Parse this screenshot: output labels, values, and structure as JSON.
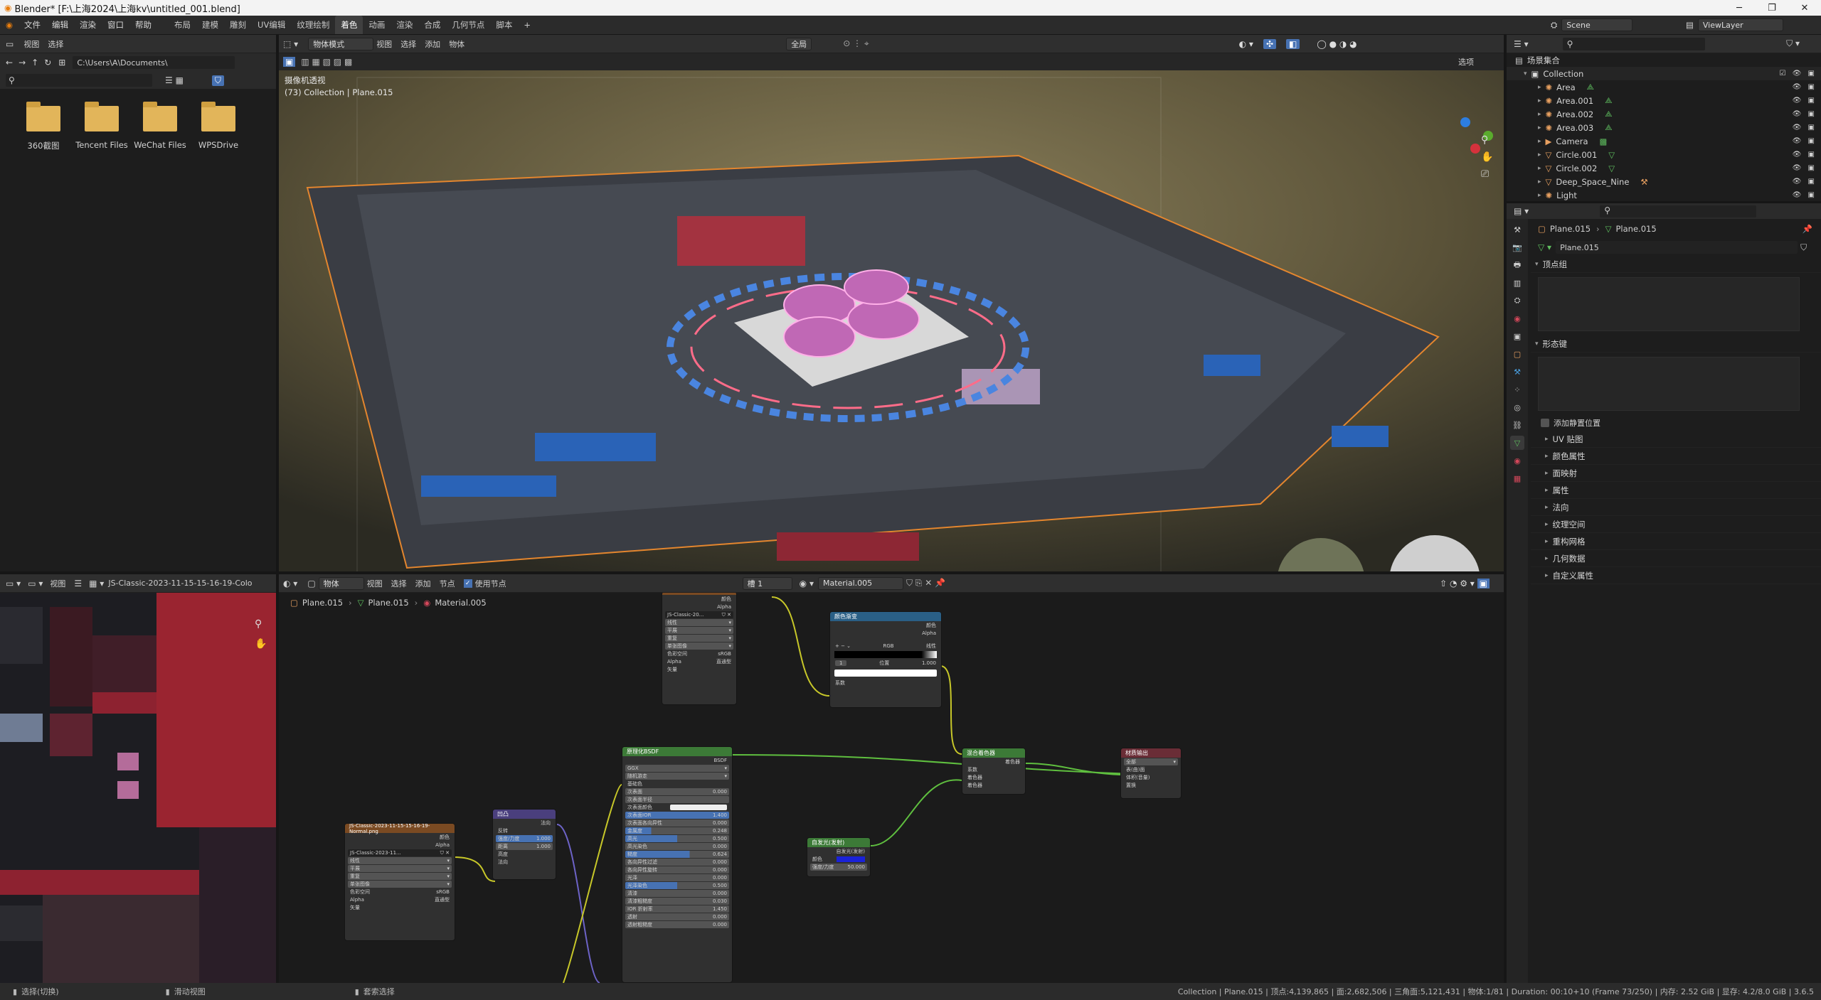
{
  "titlebar": {
    "title": "Blender* [F:\\上海2024\\上海kv\\untitled_001.blend]",
    "min": "─",
    "max": "❐",
    "close": "✕"
  },
  "topmenu": [
    "文件",
    "编辑",
    "渲染",
    "窗口",
    "帮助"
  ],
  "workspaces": [
    "布局",
    "建模",
    "雕刻",
    "UV编辑",
    "纹理绘制",
    "着色",
    "动画",
    "渲染",
    "合成",
    "几何节点",
    "脚本",
    "+"
  ],
  "scene": {
    "label": "Scene",
    "viewlayer": "ViewLayer"
  },
  "filebrowser": {
    "menu": [
      "视图",
      "选择"
    ],
    "path": "C:\\Users\\A\\Documents\\",
    "folders": [
      "360截图",
      "Tencent Files",
      "WeChat Files",
      "WPSDrive"
    ]
  },
  "viewport": {
    "mode": "物体模式",
    "menu": [
      "视图",
      "选择",
      "添加",
      "物体"
    ],
    "transform": "全局",
    "options": "选项",
    "overlay_title": "摄像机透视",
    "overlay_sub": "(73) Collection | Plane.015"
  },
  "outliner": {
    "root": "场景集合",
    "collection": "Collection",
    "items": [
      "Area",
      "Area.001",
      "Area.002",
      "Area.003",
      "Camera",
      "Circle.001",
      "Circle.002",
      "Deep_Space_Nine",
      "Light"
    ]
  },
  "properties": {
    "breadcrumb_obj": "Plane.015",
    "breadcrumb_mesh": "Plane.015",
    "mesh_name": "Plane.015",
    "vertex_groups": "顶点组",
    "shape_keys": "形态键",
    "add_rest": "添加静置位置",
    "sections": [
      "UV 贴图",
      "颜色属性",
      "面映射",
      "属性",
      "法向",
      "纹理空间",
      "重构网格",
      "几何数据",
      "自定义属性"
    ]
  },
  "image_editor": {
    "menu": [
      "视图"
    ],
    "image_name": "JS-Classic-2023-11-15-15-16-19-Colo"
  },
  "node_editor": {
    "type": "物体",
    "menu": [
      "视图",
      "选择",
      "添加",
      "节点"
    ],
    "use_nodes": "使用节点",
    "slot": "槽 1",
    "material": "Material.005",
    "breadcrumb": [
      "Plane.015",
      "Plane.015",
      "Material.005"
    ],
    "nodes": {
      "img_top": {
        "title": "JS-Classic-20...",
        "out1": "颜色",
        "out2": "Alpha",
        "rows": [
          "线性",
          "平展",
          "重复",
          "单张图像",
          "sRGB",
          "直通型"
        ],
        "labels": [
          "色彩空间",
          "Alpha"
        ],
        "vector": "矢量"
      },
      "ramp": {
        "title": "颜色渐变",
        "out1": "颜色",
        "out2": "Alpha",
        "mode": "RGB",
        "interp": "线性",
        "pos_index": "1",
        "pos_label": "位置",
        "pos_value": "1.000",
        "fac": "系数"
      },
      "bsdf": {
        "title": "原理化BSDF",
        "out": "BSDF",
        "dist": "GGX",
        "sss": "随机游走",
        "base": "基础色",
        "rows": [
          [
            "次表面",
            "0.000"
          ],
          [
            "次表面半径",
            ""
          ],
          [
            "次表面颜色",
            ""
          ],
          [
            "次表面IOR",
            "1.400"
          ],
          [
            "次表面各向异性",
            "0.000"
          ],
          [
            "金属度",
            "0.248"
          ],
          [
            "高光",
            "0.500"
          ],
          [
            "高光染色",
            "0.000"
          ],
          [
            "糙度",
            "0.624"
          ],
          [
            "各向异性过滤",
            "0.000"
          ],
          [
            "各向异性旋转",
            "0.000"
          ],
          [
            "光泽",
            "0.000"
          ],
          [
            "光泽染色",
            "0.500"
          ],
          [
            "清漆",
            "0.000"
          ],
          [
            "清漆粗糙度",
            "0.030"
          ],
          [
            "IOR 折射率",
            "1.450"
          ],
          [
            "透射",
            "0.000"
          ],
          [
            "透射粗糙度",
            "0.000"
          ]
        ]
      },
      "mix": {
        "title": "混合着色器",
        "out": "着色器",
        "fac": "系数",
        "in1": "着色器",
        "in2": "着色器"
      },
      "output": {
        "title": "材质输出",
        "target": "全部",
        "in1": "表(曲)面",
        "in2": "体积(音量)",
        "in3": "置换"
      },
      "img_normal": {
        "title": "JS-Classic-2023-11-15-15-16-19-Normal.png",
        "name": "JS-Classic-2023-11...",
        "out1": "颜色",
        "out2": "Alpha",
        "rows": [
          "线性",
          "平展",
          "重复",
          "单张图像",
          "sRGB",
          "直通型"
        ],
        "labels": [
          "色彩空间",
          "Alpha"
        ],
        "vector": "矢量"
      },
      "bump": {
        "title": "凹凸",
        "out": "法向",
        "invert": "反转",
        "strength": "强度/力度",
        "strength_val": "1.000",
        "distance": "距离",
        "distance_val": "1.000",
        "height": "高度",
        "normal": "法向"
      },
      "emission": {
        "title": "自发光(发射)",
        "out": "自发光(发射)",
        "color": "颜色",
        "strength": "强度/力度",
        "strength_val": "50.000"
      }
    }
  },
  "statusbar": {
    "left1": "选择(切换)",
    "left2": "滑动视图",
    "left3": "套索选择",
    "right": "Collection | Plane.015 | 顶点:4,139,865 | 面:2,682,506 | 三角面:5,121,431 | 物体:1/81 | Duration: 00:10+10 (Frame 73/250) | 内存: 2.52 GiB | 显存: 4.2/8.0 GiB | 3.6.5"
  },
  "colors": {
    "accent": "#4772b3",
    "selected_tab": "#3f3f3f",
    "shader_node": "#3c7a37",
    "output_node": "#6a2d36",
    "texture_node": "#7a4a22",
    "vector_node": "#4a3f7d",
    "ramp_node": "#2a5f86"
  }
}
